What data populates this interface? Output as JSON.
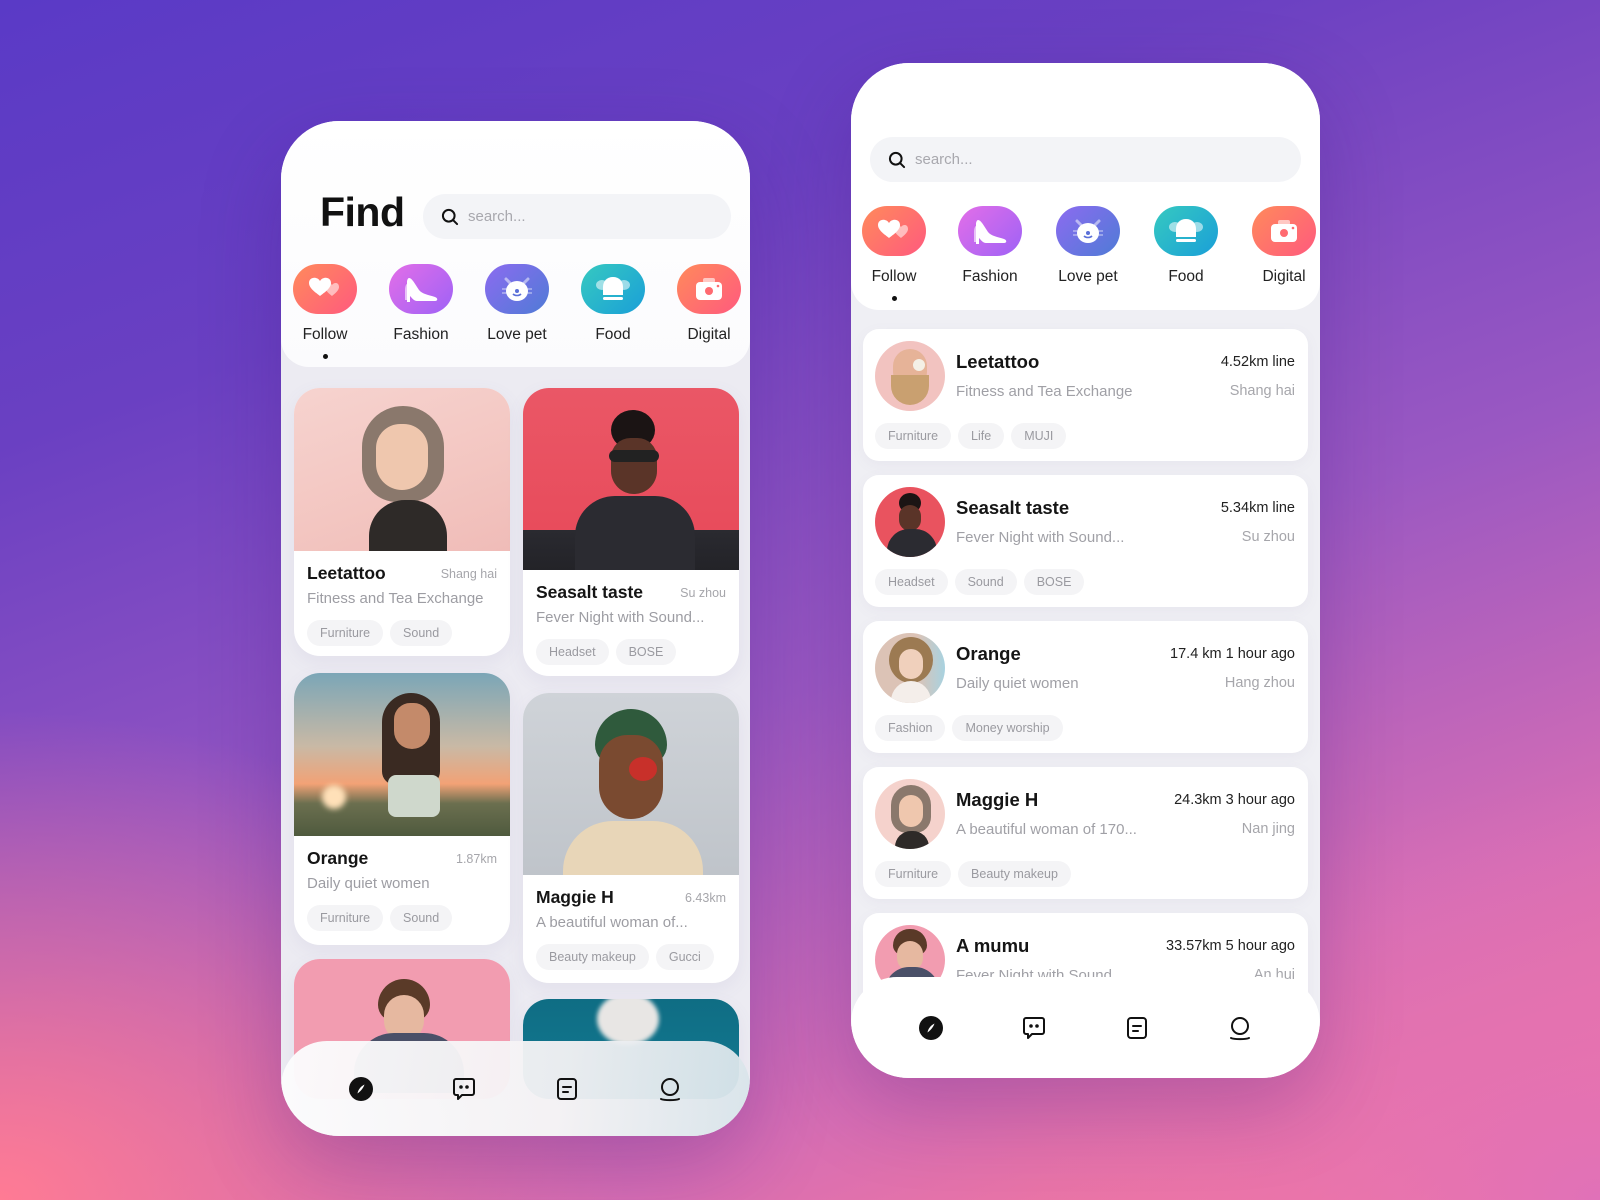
{
  "colors": {
    "bg_top": "#5a3ac6",
    "bg_bottom": "#ff7b94",
    "text_primary": "#151515",
    "text_secondary": "#a0a0a6",
    "tag_bg": "#f4f4f6",
    "search_bg": "#f3f4f7"
  },
  "left_screen": {
    "title": "Find",
    "search": {
      "placeholder": "search..."
    },
    "categories": [
      {
        "label": "Follow",
        "icon": "hearts-icon",
        "active": true
      },
      {
        "label": "Fashion",
        "icon": "high-heel-icon",
        "active": false
      },
      {
        "label": "Love pet",
        "icon": "cat-face-icon",
        "active": false
      },
      {
        "label": "Food",
        "icon": "chef-hat-icon",
        "active": false
      },
      {
        "label": "Digital",
        "icon": "camera-icon",
        "active": false
      }
    ],
    "cards": [
      {
        "name": "Leetattoo",
        "meta": "Shang hai",
        "desc": "Fitness and Tea Exchange",
        "tags": [
          "Furniture",
          "Sound"
        ]
      },
      {
        "name": "Seasalt taste",
        "meta": "Su zhou",
        "desc": "Fever Night with Sound...",
        "tags": [
          "Headset",
          "BOSE"
        ]
      },
      {
        "name": "Orange",
        "meta": "1.87km",
        "desc": "Daily quiet women",
        "tags": [
          "Furniture",
          "Sound"
        ]
      },
      {
        "name": "Maggie H",
        "meta": "6.43km",
        "desc": "A beautiful woman of...",
        "tags": [
          "Beauty makeup",
          "Gucci"
        ]
      }
    ],
    "tabbar": [
      {
        "icon": "compass-icon",
        "active": true
      },
      {
        "icon": "chat-icon",
        "active": false
      },
      {
        "icon": "document-icon",
        "active": false
      },
      {
        "icon": "profile-icon",
        "active": false
      }
    ]
  },
  "right_screen": {
    "search": {
      "placeholder": "search..."
    },
    "categories": [
      {
        "label": "Follow",
        "icon": "hearts-icon",
        "active": true
      },
      {
        "label": "Fashion",
        "icon": "high-heel-icon",
        "active": false
      },
      {
        "label": "Love pet",
        "icon": "cat-face-icon",
        "active": false
      },
      {
        "label": "Food",
        "icon": "chef-hat-icon",
        "active": false
      },
      {
        "label": "Digital",
        "icon": "camera-icon",
        "active": false
      }
    ],
    "list": [
      {
        "name": "Leetattoo",
        "desc": "Fitness and Tea Exchange",
        "dist": "4.52km line",
        "city": "Shang hai",
        "tags": [
          "Furniture",
          "Life",
          "MUJI"
        ]
      },
      {
        "name": "Seasalt taste",
        "desc": "Fever Night with Sound...",
        "dist": "5.34km line",
        "city": "Su zhou",
        "tags": [
          "Headset",
          "Sound",
          "BOSE"
        ]
      },
      {
        "name": "Orange",
        "desc": "Daily quiet women",
        "dist": "17.4 km 1 hour ago",
        "city": "Hang zhou",
        "tags": [
          "Fashion",
          "Money worship"
        ]
      },
      {
        "name": "Maggie H",
        "desc": "A beautiful woman of 170...",
        "dist": "24.3km  3 hour ago",
        "city": "Nan jing",
        "tags": [
          "Furniture",
          "Beauty makeup"
        ]
      },
      {
        "name": "A mumu",
        "desc": "Fever Night with Sound...",
        "dist": "33.57km  5 hour ago",
        "city": "An hui",
        "tags": []
      }
    ],
    "tabbar": [
      {
        "icon": "compass-icon",
        "active": true
      },
      {
        "icon": "chat-icon",
        "active": false
      },
      {
        "icon": "document-icon",
        "active": false
      },
      {
        "icon": "profile-icon",
        "active": false
      }
    ]
  }
}
